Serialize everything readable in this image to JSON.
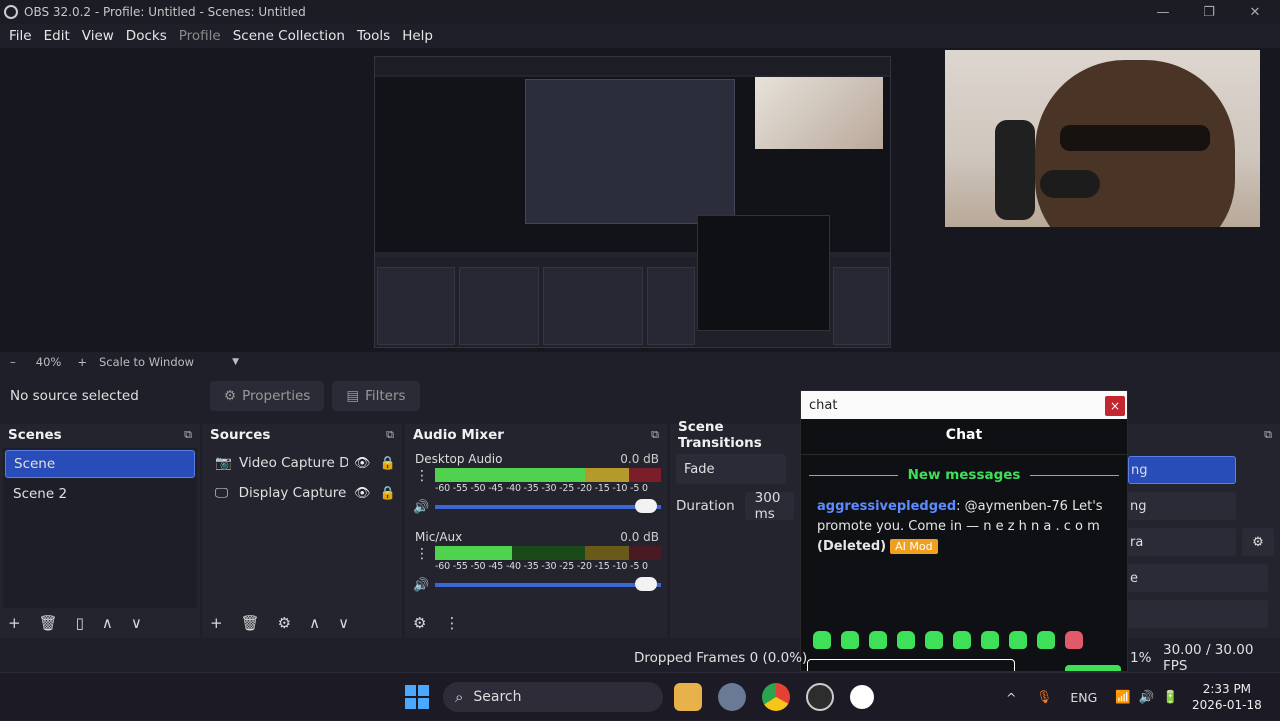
{
  "window": {
    "title": "OBS 32.0.2 - Profile: Untitled - Scenes: Untitled",
    "controls": [
      "—",
      "❐",
      "✕"
    ]
  },
  "menu": [
    "File",
    "Edit",
    "View",
    "Docks",
    "Profile",
    "Scene Collection",
    "Tools",
    "Help"
  ],
  "zoom": {
    "minus": "–",
    "value": "40%",
    "plus": "+",
    "mode": "Scale to Window",
    "arrow": "▼"
  },
  "source_bar": {
    "no_selection": "No source selected",
    "properties": "Properties",
    "filters": "Filters"
  },
  "scenes": {
    "title": "Scenes",
    "float": "⧉",
    "items": [
      {
        "label": "Scene",
        "selected": true
      },
      {
        "label": "Scene 2",
        "selected": false
      }
    ],
    "footer": [
      "+",
      "🗑",
      "▯",
      "∧",
      "∨"
    ]
  },
  "sources": {
    "title": "Sources",
    "float": "⧉",
    "items": [
      {
        "label": "Video Capture De",
        "icon": "camera-icon",
        "icon_glyph": "📷",
        "eye": "👁",
        "lock": "🔒"
      },
      {
        "label": "Display Capture",
        "icon": "monitor-icon",
        "icon_glyph": "🖵",
        "eye": "👁",
        "lock": "🔒"
      }
    ],
    "footer": [
      "+",
      "🗑",
      "⚙",
      "∧",
      "∨"
    ]
  },
  "mixer": {
    "title": "Audio Mixer",
    "float": "⧉",
    "scale": "-60 -55 -50 -45 -40 -35 -30 -25 -20 -15 -10  -5   0",
    "channels": [
      {
        "name": "Desktop Audio",
        "db": "0.0 dB",
        "level": 0.84,
        "volume": 1.0
      },
      {
        "name": "Mic/Aux",
        "db": "0.0 dB",
        "level": 0.34,
        "volume": 1.0
      }
    ],
    "footer": [
      "⚙",
      "⋮"
    ]
  },
  "transitions": {
    "title": "Scene Transitions",
    "type": "Fade",
    "duration_label": "Duration",
    "duration_value": "300 ms"
  },
  "controls": {
    "float": "⧉",
    "items": [
      "ng",
      "ng",
      "ra",
      "e",
      ""
    ],
    "gear": "⚙"
  },
  "chat": {
    "window_title": "chat",
    "close": "×",
    "header": "Chat",
    "new_messages": "New messages",
    "message": {
      "user": "aggressivepledged",
      "text": ": @aymenben-76 Let's promote you. Come in — n e z h n a . c o m",
      "status": "(Deleted)",
      "badge": "AI Mod"
    }
  },
  "status": {
    "dropped": "Dropped Frames 0 (0.0%)",
    "cpu": "1%",
    "fps": "30.00 / 30.00 FPS"
  },
  "taskbar": {
    "search": "Search",
    "tray_lang": "ENG",
    "time": "2:33 PM",
    "date": "2026-01-18",
    "tray_chevron": "^",
    "mic": "🎙",
    "wifi": "📶",
    "volume": "🔊",
    "battery": "🔋"
  },
  "colors": {
    "accent": "#284cb8",
    "meter_green": "#4fd34f",
    "chat_green": "#3ee05a",
    "chat_user": "#5d8bff",
    "badge": "#f0a020",
    "close_red": "#c2262e"
  }
}
